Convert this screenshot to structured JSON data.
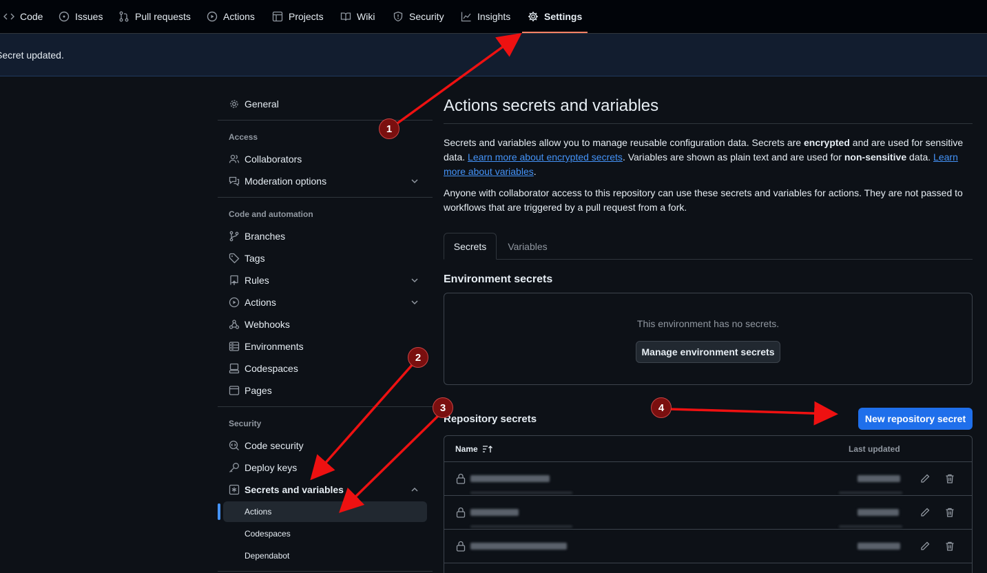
{
  "topnav": {
    "tabs": [
      {
        "label": "Code",
        "icon": "code-icon"
      },
      {
        "label": "Issues",
        "icon": "issue-opened-icon"
      },
      {
        "label": "Pull requests",
        "icon": "git-pull-request-icon"
      },
      {
        "label": "Actions",
        "icon": "play-icon"
      },
      {
        "label": "Projects",
        "icon": "table-icon"
      },
      {
        "label": "Wiki",
        "icon": "book-icon"
      },
      {
        "label": "Security",
        "icon": "shield-icon"
      },
      {
        "label": "Insights",
        "icon": "graph-icon"
      },
      {
        "label": "Settings",
        "icon": "gear-icon",
        "active": true
      }
    ]
  },
  "flash": {
    "message": "Secret updated."
  },
  "sidebar": {
    "general": "General",
    "access_heading": "Access",
    "collaborators": "Collaborators",
    "moderation": "Moderation options",
    "code_heading": "Code and automation",
    "branches": "Branches",
    "tags": "Tags",
    "rules": "Rules",
    "actions": "Actions",
    "webhooks": "Webhooks",
    "environments": "Environments",
    "codespaces": "Codespaces",
    "pages": "Pages",
    "security_heading": "Security",
    "code_security": "Code security",
    "deploy_keys": "Deploy keys",
    "secrets_variables": "Secrets and variables",
    "sub_actions": "Actions",
    "sub_codespaces": "Codespaces",
    "sub_dependabot": "Dependabot"
  },
  "main": {
    "title": "Actions secrets and variables",
    "p1_a": "Secrets and variables allow you to manage reusable configuration data. Secrets are ",
    "p1_b": "encrypted",
    "p1_c": " and are used for sensitive data. ",
    "p1_link1": "Learn more about encrypted secrets",
    "p1_d": ". Variables are shown as plain text and are used for ",
    "p1_e": "non-sensitive",
    "p1_f": " data. ",
    "p1_link2": "Learn more about variables",
    "p1_g": ".",
    "p2": "Anyone with collaborator access to this repository can use these secrets and variables for actions. They are not passed to workflows that are triggered by a pull request from a fork.",
    "tab_secrets": "Secrets",
    "tab_variables": "Variables",
    "env_title": "Environment secrets",
    "env_empty": "This environment has no secrets.",
    "env_button": "Manage environment secrets",
    "repo_title": "Repository secrets",
    "new_button": "New repository secret",
    "col_name": "Name",
    "col_updated": "Last updated",
    "rows": [
      {
        "name": "",
        "updated": ""
      },
      {
        "name": "",
        "updated": ""
      },
      {
        "name": "",
        "updated": ""
      }
    ]
  },
  "annotations": {
    "badges": [
      "1",
      "2",
      "3",
      "4"
    ],
    "color": "#ee1111"
  }
}
